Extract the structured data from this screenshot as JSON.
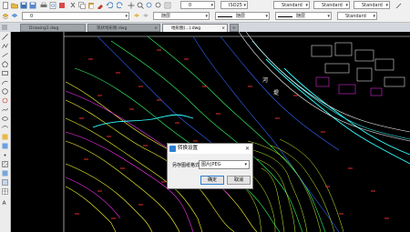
{
  "toolbar": {
    "layer_value": "0",
    "color_value": "随层",
    "linetype_value": "随层",
    "lineweight_value": "随层",
    "textstyle_value": "Standard",
    "dimstyle_value": "Standard",
    "tablestyle_value": "Standard",
    "scale_value": "ISO25",
    "style_value": "Standard",
    "layer2_value": "0",
    "color2_value": "随层"
  },
  "tabs": [
    {
      "label": "Drawing1.dwg"
    },
    {
      "label": "现状地形图.dwg"
    },
    {
      "label": "地形图(...).dwg"
    }
  ],
  "dialog": {
    "title": "转换设置",
    "field_label": "另存图纸格式:",
    "select_value": "图片JPEG",
    "ok_label": "确定",
    "cancel_label": "取消"
  },
  "map_labels": {
    "label1": "河",
    "label2": "堤"
  },
  "colors": {
    "canvas": "#000000",
    "accent": "#2d7fd1"
  }
}
